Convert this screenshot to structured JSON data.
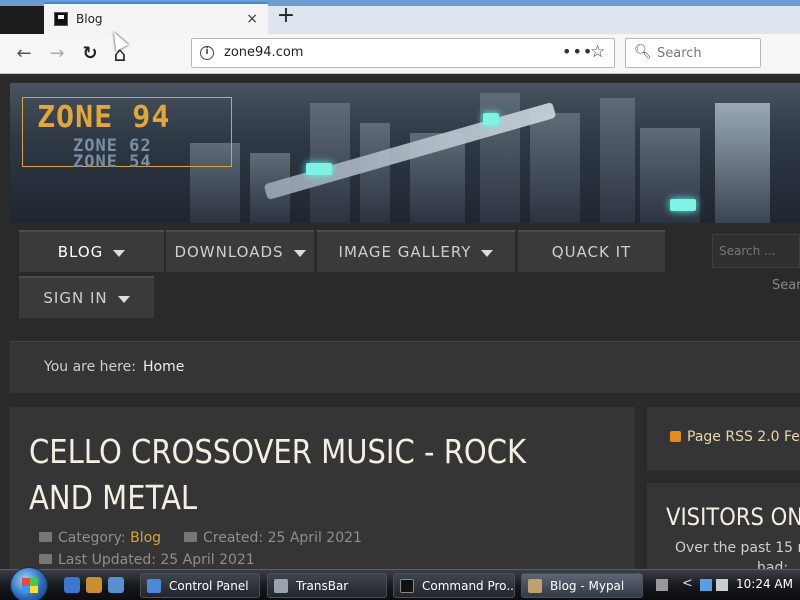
{
  "browser": {
    "tab_title": "Blog",
    "tab_close": "×",
    "new_tab": "+",
    "back": "←",
    "forward": "→",
    "reload": "↻",
    "home": "⌂",
    "url": "zone94.com",
    "page_actions": "•••",
    "bookmark": "☆",
    "search_placeholder": "Search"
  },
  "site": {
    "logo_main": "ZONE 94",
    "logo_sub1": "ZONE 62",
    "logo_sub2": "ZONE 54",
    "menu": [
      {
        "label": "BLOG",
        "has_caret": true
      },
      {
        "label": "DOWNLOADS",
        "has_caret": true
      },
      {
        "label": "IMAGE GALLERY",
        "has_caret": true
      },
      {
        "label": "QUACK IT",
        "has_caret": false
      },
      {
        "label": "SIGN IN",
        "has_caret": true
      }
    ],
    "menu_search_placeholder": "Search ...",
    "search_label": "Sear",
    "breadcrumb_label": "You are here:",
    "breadcrumb_home": "Home"
  },
  "article": {
    "title": "CELLO CROSSOVER MUSIC - ROCK AND METAL",
    "category_label": "Category:",
    "category_value": "Blog",
    "created_label": "Created:",
    "created_value": "25 April 2021",
    "updated_label": "Last Updated:",
    "updated_value": "25 April 2021"
  },
  "sidebar": {
    "rss_label": "Page RSS 2.0 Fe",
    "visitors_heading": "VISITORS ON",
    "visitors_line1": "Over the past 15 m",
    "visitors_line2": "had:"
  },
  "taskbar": {
    "items": [
      {
        "label": "Control Panel",
        "active": false
      },
      {
        "label": "TransBar",
        "active": false
      },
      {
        "label": "Command Pro...",
        "active": false
      },
      {
        "label": "Blog - Mypal",
        "active": true
      }
    ],
    "clock": "10:24 AM",
    "tray_chevron": "<"
  },
  "colors": {
    "accent": "#d9a33a",
    "page_bg": "#2a2a2a",
    "panel_bg": "#353535"
  }
}
